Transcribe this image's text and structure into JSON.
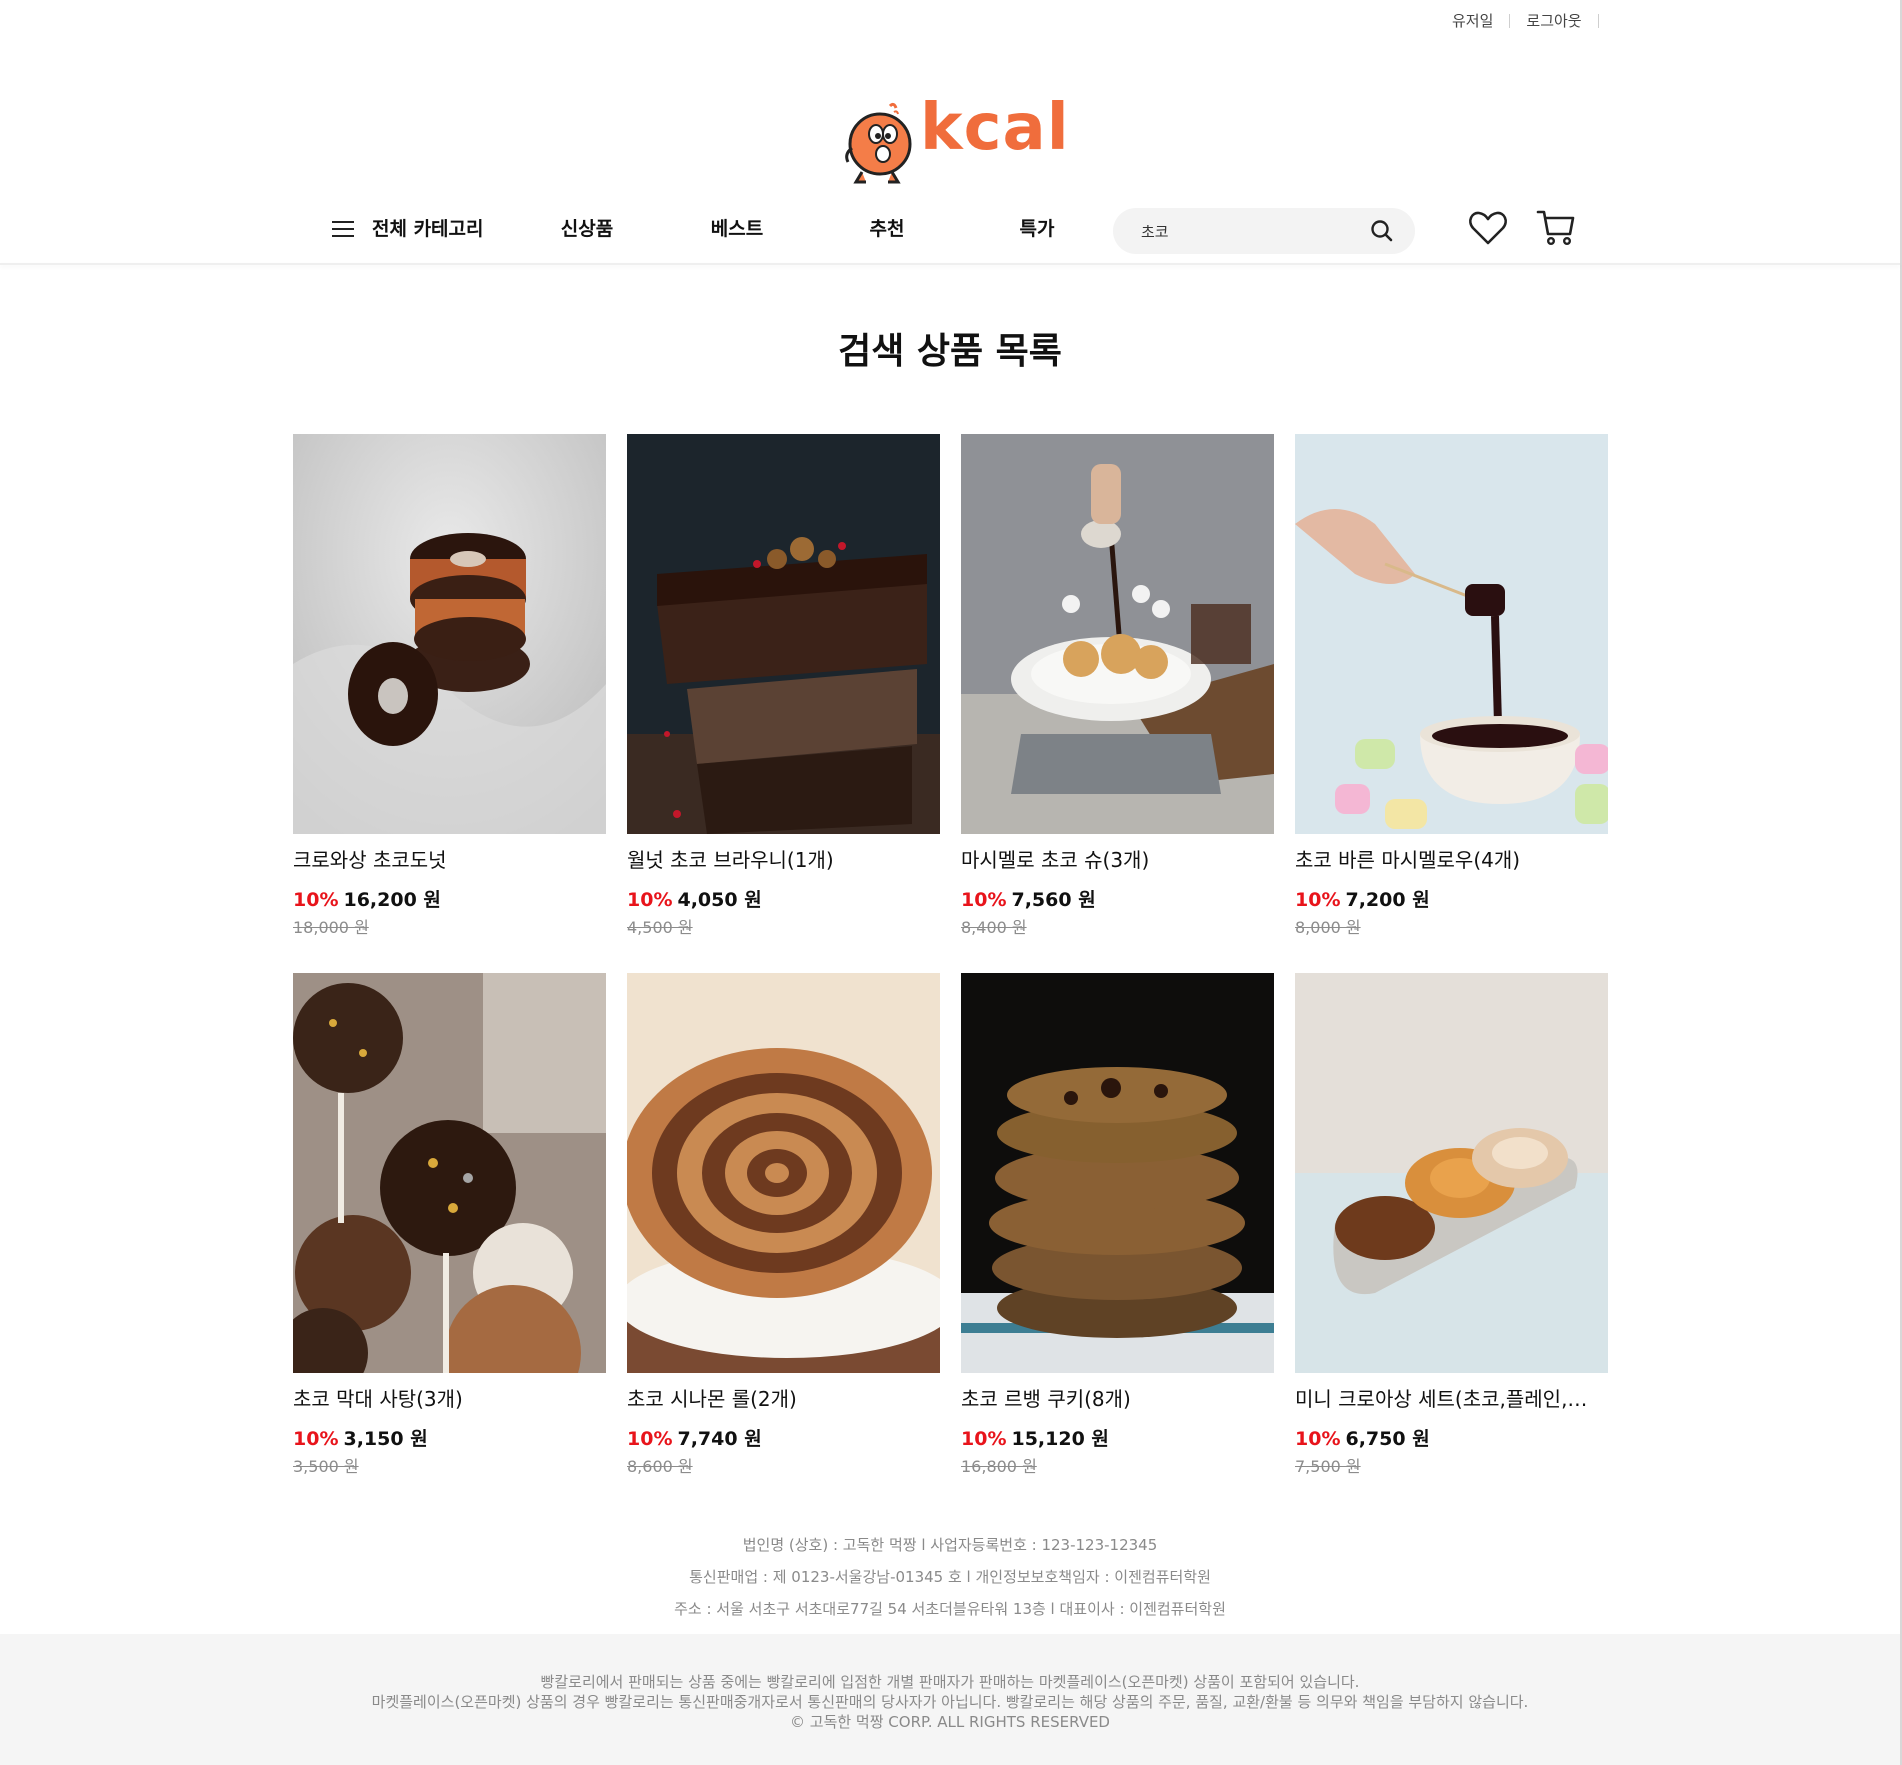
{
  "util": {
    "user": "유저일",
    "logout": "로그아웃"
  },
  "logo": {
    "text": "kcal"
  },
  "nav": {
    "all_categories": "전체 카테고리",
    "items": [
      "신상품",
      "베스트",
      "추천",
      "특가"
    ]
  },
  "search": {
    "value": "초코",
    "placeholder": ""
  },
  "page_title": "검색 상품 목록",
  "products": [
    {
      "name": "크로와상 초코도넛",
      "discount": "10%",
      "price": "16,200 원",
      "original": "18,000 원"
    },
    {
      "name": "월넛 초코 브라우니(1개)",
      "discount": "10%",
      "price": "4,050 원",
      "original": "4,500 원"
    },
    {
      "name": "마시멜로 초코 슈(3개)",
      "discount": "10%",
      "price": "7,560 원",
      "original": "8,400 원"
    },
    {
      "name": "초코 바른 마시멜로우(4개)",
      "discount": "10%",
      "price": "7,200 원",
      "original": "8,000 원"
    },
    {
      "name": "초코 막대 사탕(3개)",
      "discount": "10%",
      "price": "3,150 원",
      "original": "3,500 원"
    },
    {
      "name": "초코 시나몬 롤(2개)",
      "discount": "10%",
      "price": "7,740 원",
      "original": "8,600 원"
    },
    {
      "name": "초코 르뱅 쿠키(8개)",
      "discount": "10%",
      "price": "15,120 원",
      "original": "16,800 원"
    },
    {
      "name": "미니 크로아상 세트(초코,플레인,…",
      "discount": "10%",
      "price": "6,750 원",
      "original": "7,500 원"
    }
  ],
  "footer": {
    "info": [
      "법인명 (상호) : 고독한 먹짱 l 사업자등록번호 : 123-123-12345",
      "통신판매업 : 제 0123-서울강남-01345 호 l 개인정보보호책임자 : 이젠컴퓨터학원",
      "주소 : 서울 서초구 서초대로77길 54 서초더블유타워 13층 l 대표이사 : 이젠컴퓨터학원"
    ],
    "notice": [
      "빵칼로리에서 판매되는 상품 중에는 빵칼로리에 입점한 개별 판매자가 판매하는 마켓플레이스(오픈마켓) 상품이 포함되어 있습니다.",
      "마켓플레이스(오픈마켓) 상품의 경우 빵칼로리는 통신판매중개자로서 통신판매의 당사자가 아닙니다. 빵칼로리는 해당 상품의 주문, 품질, 교환/환불 등 의무와 책임을 부담하지 않습니다.",
      "© 고독한 먹짱 CORP. ALL RIGHTS RESERVED"
    ]
  },
  "colors": {
    "brand": "#f06d3c",
    "discount": "#e8141b",
    "footer_bg": "#f5f5f5",
    "search_bg": "#f3f3f3"
  },
  "icons": {
    "menu": "hamburger-icon",
    "search": "search-icon",
    "wishlist": "heart-icon",
    "cart": "cart-icon"
  }
}
